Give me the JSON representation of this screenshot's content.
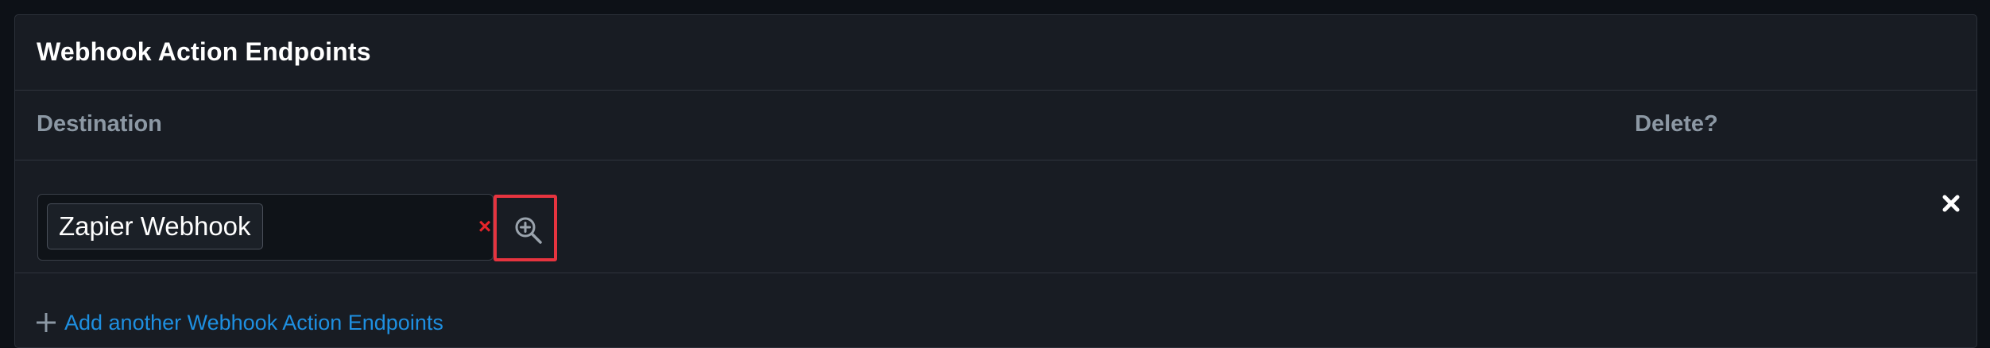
{
  "panel": {
    "title": "Webhook Action Endpoints"
  },
  "columns": {
    "destination": "Destination",
    "delete": "Delete?"
  },
  "rows": [
    {
      "destination_value": "Zapier Webhook",
      "clear_symbol": "×",
      "lookup_icon": "zoom-in-icon",
      "delete_icon": "close-icon"
    }
  ],
  "add_link": {
    "label": "Add another Webhook Action Endpoints",
    "icon": "plus-icon"
  },
  "colors": {
    "background": "#0d1117",
    "panel": "#181c23",
    "link": "#1e8fe0",
    "clear": "#e5252a",
    "highlight": "#e6343f"
  }
}
